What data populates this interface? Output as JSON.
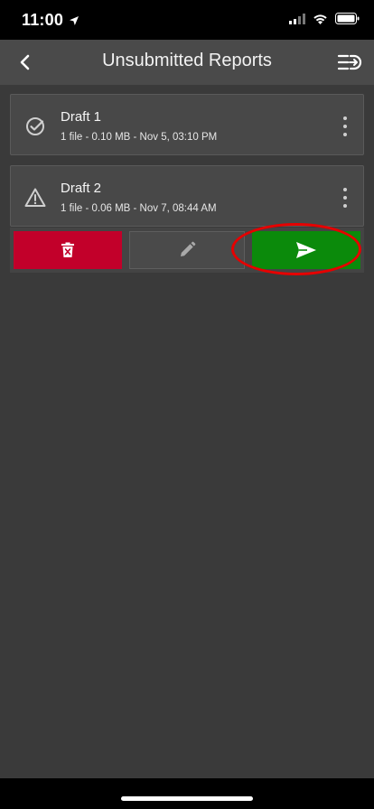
{
  "status_bar": {
    "time": "11:00",
    "icons": [
      "location-arrow-icon",
      "cellular-signal-icon",
      "wifi-icon",
      "battery-icon"
    ]
  },
  "header": {
    "title": "Unsubmitted Reports",
    "back_icon": "chevron-left-icon",
    "menu_icon": "queue-menu-icon"
  },
  "reports": [
    {
      "title": "Draft 1",
      "meta": "1 file - 0.10 MB - Nov 5, 03:10 PM",
      "status_icon": "check-circle-icon"
    },
    {
      "title": "Draft 2",
      "meta": "1 file - 0.06 MB - Nov 7, 08:44 AM",
      "status_icon": "warning-triangle-icon"
    }
  ],
  "actions": {
    "delete_icon": "trash-icon",
    "edit_icon": "pencil-icon",
    "send_icon": "send-icon",
    "colors": {
      "delete": "#c2002a",
      "send": "#0b8a0b",
      "highlight": "#e60000"
    }
  }
}
